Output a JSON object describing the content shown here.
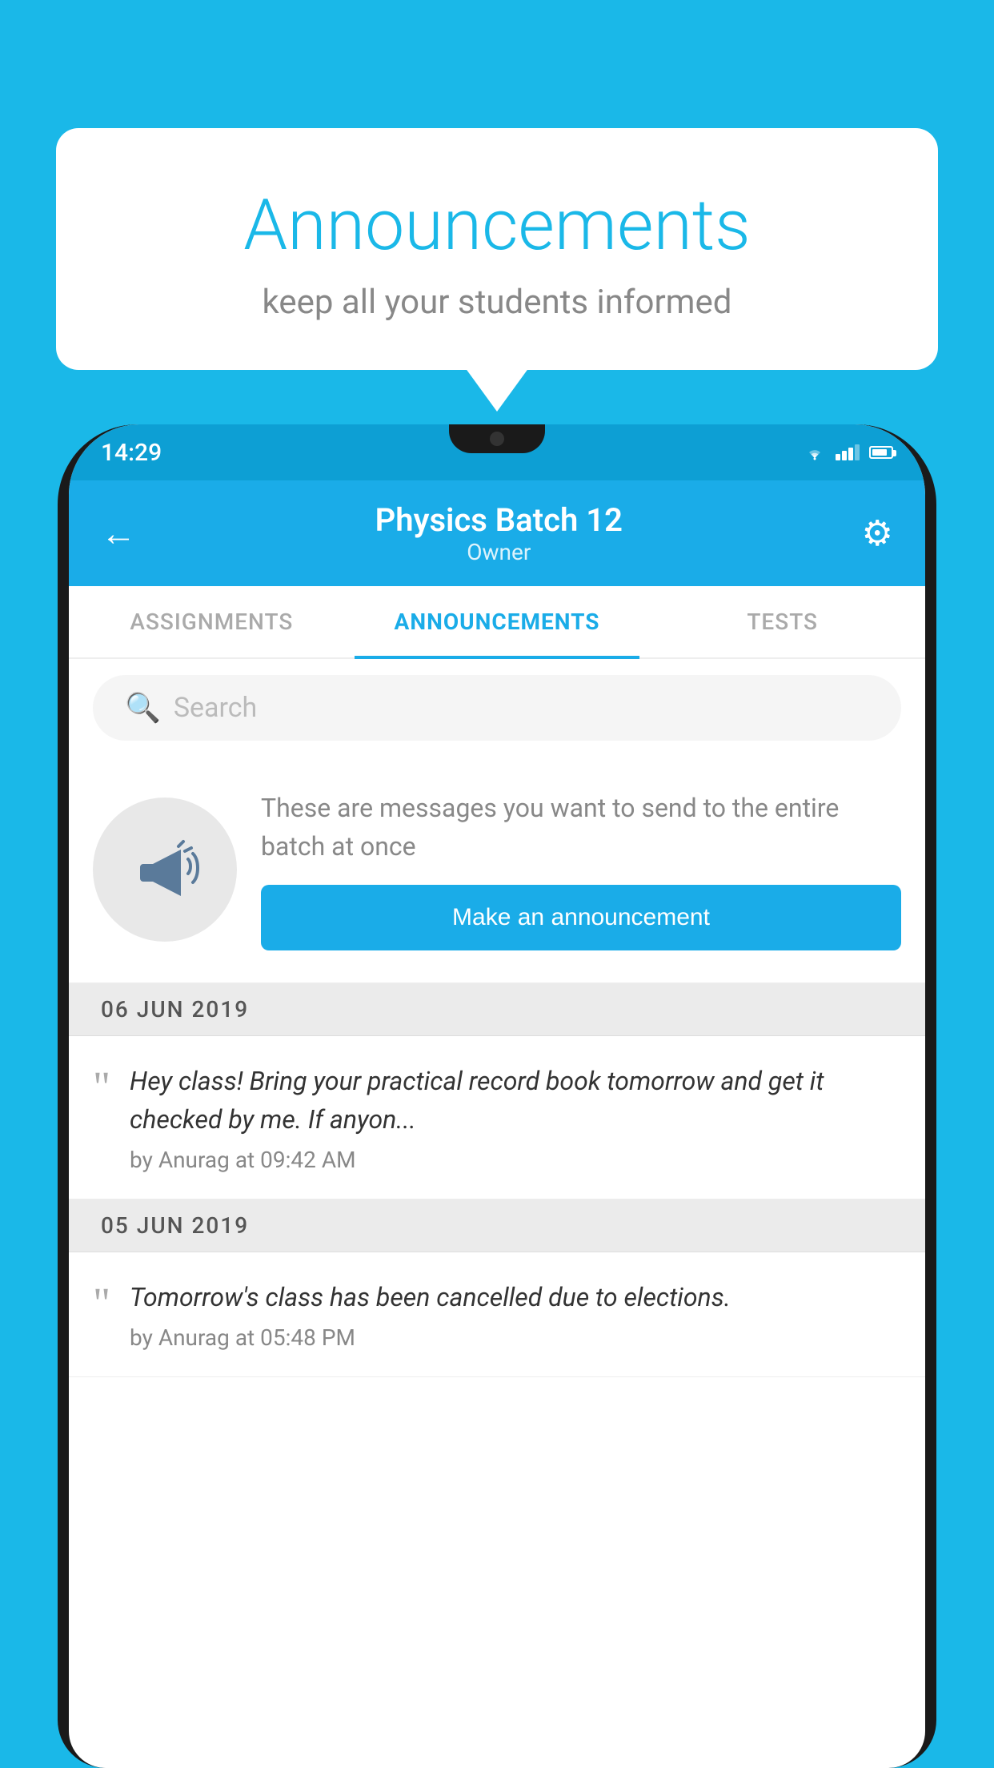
{
  "background": {
    "color": "#1ab8e8"
  },
  "speech_bubble": {
    "title": "Announcements",
    "subtitle": "keep all your students informed"
  },
  "status_bar": {
    "time": "14:29",
    "wifi": true,
    "signal": true,
    "battery": true
  },
  "app_header": {
    "back_icon": "←",
    "title": "Physics Batch 12",
    "subtitle": "Owner",
    "gear_icon": "⚙"
  },
  "tabs": [
    {
      "label": "ASSIGNMENTS",
      "active": false
    },
    {
      "label": "ANNOUNCEMENTS",
      "active": true
    },
    {
      "label": "TESTS",
      "active": false
    },
    {
      "label": "...",
      "active": false
    }
  ],
  "search": {
    "placeholder": "Search"
  },
  "announcement_cta": {
    "description": "These are messages you want to send to the entire batch at once",
    "button_label": "Make an announcement"
  },
  "announcements": [
    {
      "date": "06  JUN  2019",
      "items": [
        {
          "text": "Hey class! Bring your practical record book tomorrow and get it checked by me. If anyon...",
          "meta": "by Anurag at 09:42 AM"
        }
      ]
    },
    {
      "date": "05  JUN  2019",
      "items": [
        {
          "text": "Tomorrow's class has been cancelled due to elections.",
          "meta": "by Anurag at 05:48 PM"
        }
      ]
    }
  ]
}
